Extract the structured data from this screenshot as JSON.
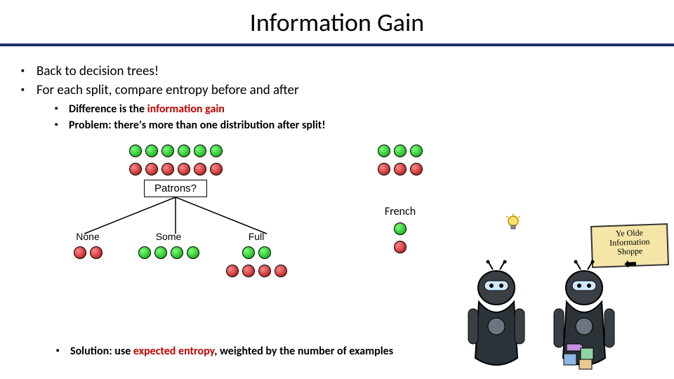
{
  "title": "Information Gain",
  "bullets": {
    "p1": "Back to decision trees!",
    "p2": "For each split, compare entropy before and after",
    "c1a": "Difference is the ",
    "c1b": "information gain",
    "c2": "Problem: there's more than one distribution after split!",
    "sol_a": "Solution: use ",
    "sol_b": "expected entropy",
    "sol_c": ", weighted by the number of examples"
  },
  "diagram": {
    "attr1": "Patrons?",
    "labels1": [
      "None",
      "Some",
      "Full"
    ],
    "right_label": "French"
  },
  "cartoon": {
    "sign_line1": "Ye Olde",
    "sign_line2": "Information",
    "sign_line3": "Shoppe"
  }
}
